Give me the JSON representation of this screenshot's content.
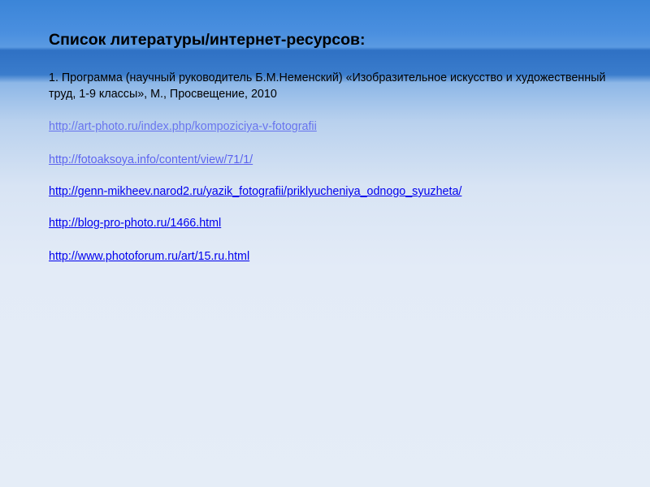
{
  "slide": {
    "title": "Список литературы/интернет-ресурсов:",
    "reference": "1. Программа (научный руководитель Б.М.Неменский) «Изобразительное искусство и художественный труд, 1-9 классы», М., Просвещение, 2010",
    "links": [
      "http://art-photo.ru/index.php/kompoziciya-v-fotografii",
      "http://fotoaksoya.info/content/view/71/1/",
      "http://genn-mikheev.narod2.ru/yazik_fotografii/priklyucheniya_odnogo_syuzheta/",
      "http://blog-pro-photo.ru/1466.html",
      "http://www.photoforum.ru/art/15.ru.html"
    ]
  },
  "colors": {
    "background_top": "#3b85d8",
    "background_band": "#2f71c4",
    "background_bottom": "#e5edf7",
    "text": "#000000",
    "link": "#0000ee"
  }
}
